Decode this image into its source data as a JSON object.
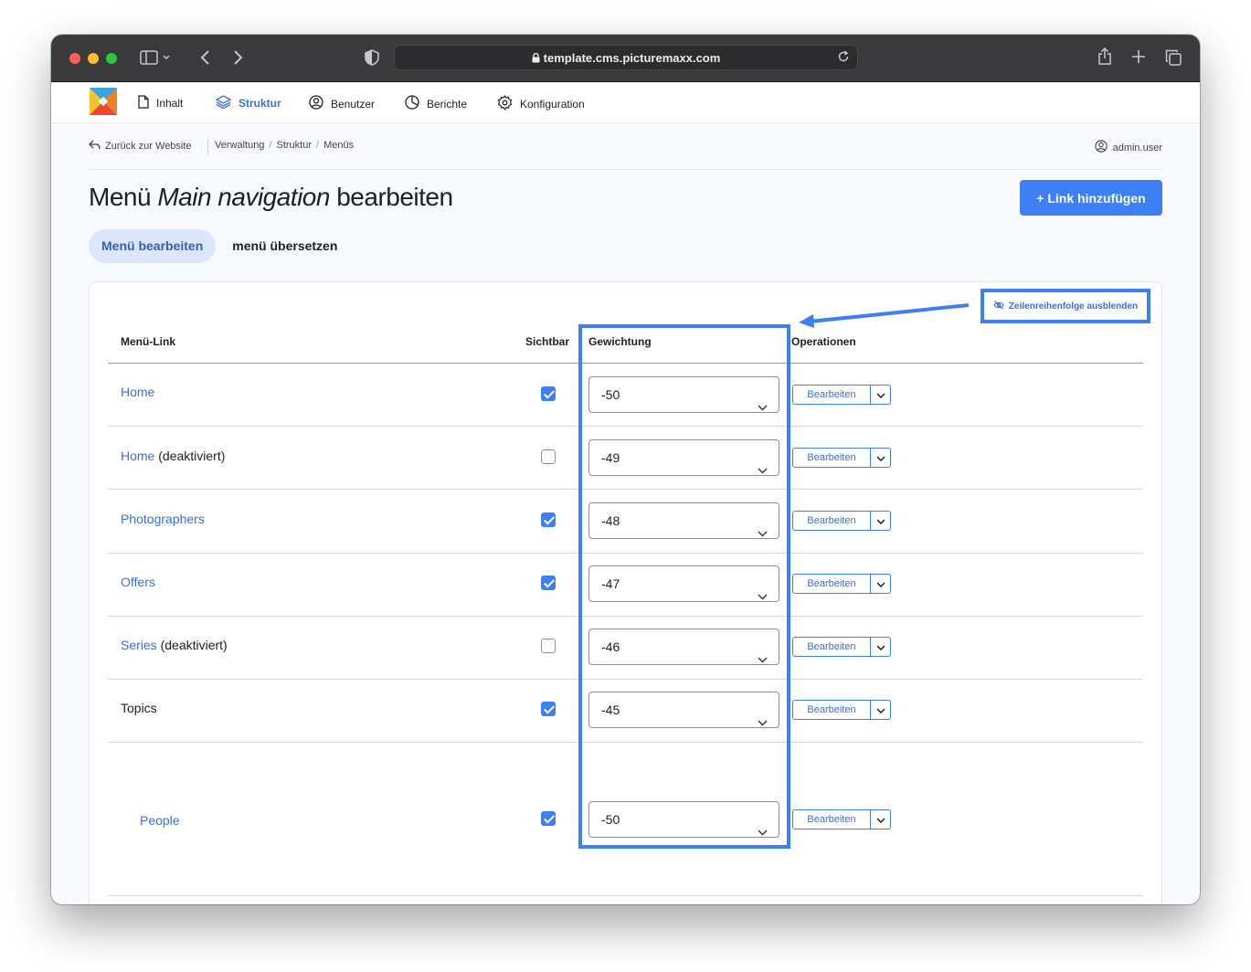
{
  "browser": {
    "url": "template.cms.picturemaxx.com"
  },
  "nav": {
    "items": [
      {
        "label": "Inhalt",
        "icon": "file-icon"
      },
      {
        "label": "Struktur",
        "icon": "layers-icon",
        "active": true
      },
      {
        "label": "Benutzer",
        "icon": "user-circle-icon"
      },
      {
        "label": "Berichte",
        "icon": "pie-chart-icon"
      },
      {
        "label": "Konfiguration",
        "icon": "gear-icon"
      }
    ]
  },
  "breadcrumb": {
    "back": "Zurück zur Website",
    "trail": [
      "Verwaltung",
      "Struktur",
      "Menüs"
    ],
    "user": "admin.user"
  },
  "page": {
    "title_prefix": "Menü",
    "title_name": "Main navigation",
    "title_suffix": "bearbeiten",
    "add_button": "+ Link hinzufügen"
  },
  "tabs": [
    {
      "label": "Menü bearbeiten",
      "active": true
    },
    {
      "label": "menü übersetzen",
      "active": false
    }
  ],
  "table": {
    "toggle_order_label": "Zeilenreihenfolge ausblenden",
    "columns": [
      "Menü-Link",
      "Sichtbar",
      "Gewichtung",
      "Operationen"
    ],
    "rows": [
      {
        "link": "Home",
        "suffix": "",
        "visible": true,
        "weight": "-50",
        "op": "Bearbeiten"
      },
      {
        "link": "Home",
        "suffix": "(deaktiviert)",
        "visible": false,
        "weight": "-49",
        "op": "Bearbeiten"
      },
      {
        "link": "Photographers",
        "suffix": "",
        "visible": true,
        "weight": "-48",
        "op": "Bearbeiten"
      },
      {
        "link": "Offers",
        "suffix": "",
        "visible": true,
        "weight": "-47",
        "op": "Bearbeiten"
      },
      {
        "link": "Series",
        "suffix": "(deaktiviert)",
        "visible": false,
        "weight": "-46",
        "op": "Bearbeiten"
      },
      {
        "link": "Topics",
        "suffix": "",
        "visible": true,
        "weight": "-45",
        "op": "Bearbeiten"
      },
      {
        "link": "People",
        "suffix": "",
        "visible": true,
        "weight": "-50",
        "op": "Bearbeiten"
      }
    ]
  },
  "colors": {
    "accent": "#3d7ff5",
    "toolbar": "#3a3a3c"
  }
}
